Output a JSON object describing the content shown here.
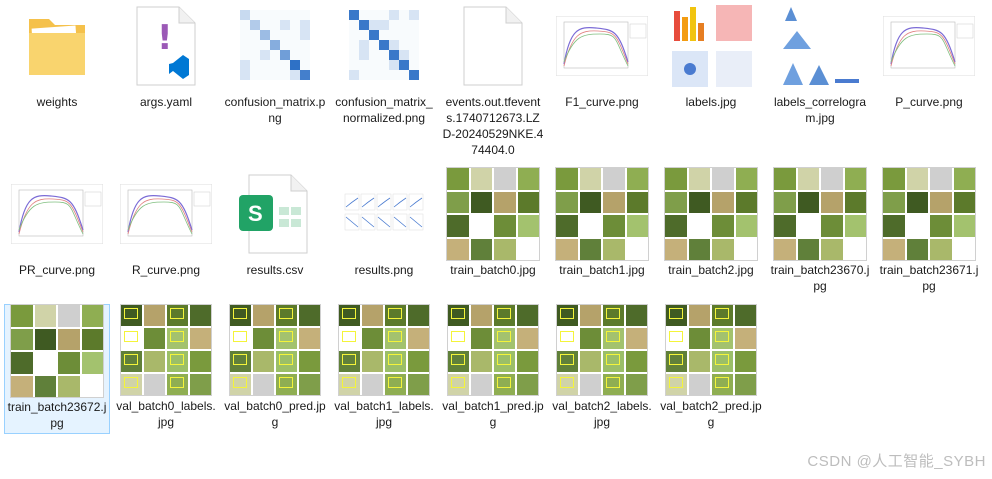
{
  "files": [
    {
      "name": "weights",
      "type": "folder"
    },
    {
      "name": "args.yaml",
      "type": "yaml"
    },
    {
      "name": "confusion_matrix.png",
      "type": "confusion"
    },
    {
      "name": "confusion_matrix_normalized.png",
      "type": "confusion-normalized"
    },
    {
      "name": "events.out.tfevents.1740712673.LZD-20240529NKE.474404.0",
      "type": "blank"
    },
    {
      "name": "F1_curve.png",
      "type": "curve"
    },
    {
      "name": "labels.jpg",
      "type": "labels"
    },
    {
      "name": "labels_correlogram.jpg",
      "type": "correlogram"
    },
    {
      "name": "P_curve.png",
      "type": "curve"
    },
    {
      "name": "PR_curve.png",
      "type": "curve"
    },
    {
      "name": "R_curve.png",
      "type": "curve"
    },
    {
      "name": "results.csv",
      "type": "csv"
    },
    {
      "name": "results.png",
      "type": "results"
    },
    {
      "name": "train_batch0.jpg",
      "type": "batch"
    },
    {
      "name": "train_batch1.jpg",
      "type": "batch"
    },
    {
      "name": "train_batch2.jpg",
      "type": "batch"
    },
    {
      "name": "train_batch23670.jpg",
      "type": "batch"
    },
    {
      "name": "train_batch23671.jpg",
      "type": "batch"
    },
    {
      "name": "train_batch23672.jpg",
      "type": "batch",
      "selected": true
    },
    {
      "name": "val_batch0_labels.jpg",
      "type": "valbatch"
    },
    {
      "name": "val_batch0_pred.jpg",
      "type": "valbatch"
    },
    {
      "name": "val_batch1_labels.jpg",
      "type": "valbatch"
    },
    {
      "name": "val_batch1_pred.jpg",
      "type": "valbatch"
    },
    {
      "name": "val_batch2_labels.jpg",
      "type": "valbatch"
    },
    {
      "name": "val_batch2_pred.jpg",
      "type": "valbatch"
    }
  ],
  "watermark": "CSDN @人工智能_SYBH",
  "colors": {
    "folder": "#f5c14b",
    "selection": "#e5f3ff",
    "vscode": "#0078d4",
    "excel": "#21a366",
    "yaml_mark": "#9b59b6"
  }
}
